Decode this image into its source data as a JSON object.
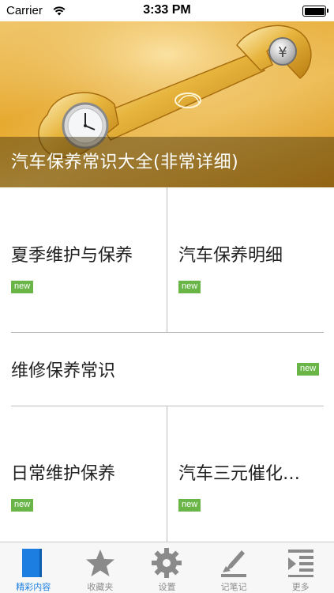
{
  "status_bar": {
    "carrier": "Carrier",
    "time": "3:33 PM"
  },
  "banner": {
    "title": "汽车保养常识大全(非常详细)"
  },
  "cards": [
    {
      "title": "夏季维护与保养",
      "badge": "new"
    },
    {
      "title": "汽车保养明细",
      "badge": "new"
    },
    {
      "title": "维修保养常识",
      "badge": "new"
    },
    {
      "title": "日常维护保养",
      "badge": "new"
    },
    {
      "title": "汽车三元催化…",
      "badge": "new"
    }
  ],
  "tabs": [
    {
      "label": "精彩内容",
      "icon": "content-icon",
      "active": true
    },
    {
      "label": "收藏夹",
      "icon": "star-icon",
      "active": false
    },
    {
      "label": "设置",
      "icon": "gear-icon",
      "active": false
    },
    {
      "label": "记笔记",
      "icon": "note-icon",
      "active": false
    },
    {
      "label": "更多",
      "icon": "more-icon",
      "active": false
    }
  ],
  "colors": {
    "accent": "#1c7ee0",
    "new_badge": "#69b548",
    "banner_gold": "#e8a928"
  }
}
